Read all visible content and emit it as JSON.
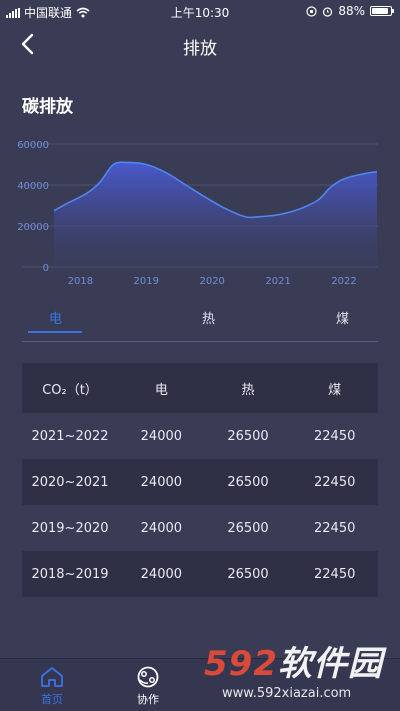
{
  "status": {
    "carrier": "中国联通",
    "time": "上午10:30",
    "battery": "88%",
    "battery_level": 0.88
  },
  "nav": {
    "title": "排放",
    "back_icon": "chevron-left-icon"
  },
  "section_title": "碳排放",
  "chart_data": {
    "type": "area",
    "x_ticks": [
      "2018",
      "2019",
      "2020",
      "2021",
      "2022"
    ],
    "y_ticks": [
      "0",
      "20000",
      "40000",
      "60000"
    ],
    "ylim": [
      0,
      60000
    ],
    "series": [
      {
        "x": [
          2017.6,
          2017.8,
          2018.1,
          2018.3,
          2018.5,
          2018.7,
          2019.0,
          2019.3,
          2019.6,
          2019.9,
          2020.2,
          2020.5,
          2020.7,
          2021.0,
          2021.3,
          2021.6,
          2021.8,
          2022.0,
          2022.3,
          2022.5
        ],
        "values": [
          27500,
          31000,
          36000,
          41500,
          50000,
          51000,
          50000,
          46000,
          40000,
          34000,
          28500,
          24500,
          24500,
          25500,
          28000,
          32500,
          39000,
          43000,
          45500,
          46500
        ]
      }
    ],
    "colors": {
      "line": "#4f86f0",
      "fill_top": "#4a5bd6",
      "fill_bottom": "#3a3d5c",
      "grid": "#575a7c",
      "tick": "#6f8fd8"
    }
  },
  "tabs": [
    {
      "label": "电",
      "active": true
    },
    {
      "label": "热",
      "active": false
    },
    {
      "label": "煤",
      "active": false
    }
  ],
  "table": {
    "headers": [
      "CO₂（t）",
      "电",
      "热",
      "煤"
    ],
    "rows": [
      [
        "2021~2022",
        "24000",
        "26500",
        "22450"
      ],
      [
        "2020~2021",
        "24000",
        "26500",
        "22450"
      ],
      [
        "2019~2020",
        "24000",
        "26500",
        "22450"
      ],
      [
        "2018~2019",
        "24000",
        "26500",
        "22450"
      ]
    ]
  },
  "bottom_nav": [
    {
      "label": "首页",
      "icon": "home-icon",
      "active": true
    },
    {
      "label": "协作",
      "icon": "collaboration-icon",
      "active": false
    }
  ],
  "watermark": {
    "logo_number": "592",
    "logo_text": "软件园",
    "url": "www.592xiazai.com"
  },
  "accent_color": "#3b73e6"
}
